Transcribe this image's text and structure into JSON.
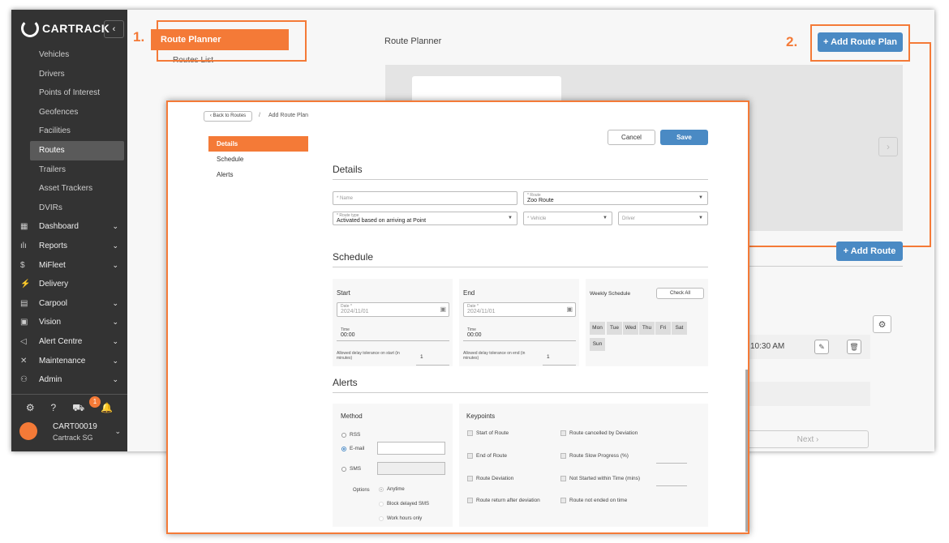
{
  "sidebar": {
    "brand": "CARTRACK",
    "collapse_icon": "‹",
    "subitems": [
      "Vehicles",
      "Drivers",
      "Points of Interest",
      "Geofences",
      "Facilities",
      "Routes",
      "Trailers",
      "Asset Trackers",
      "DVIRs"
    ],
    "active_sub": "Routes",
    "groups": [
      {
        "label": "Dashboard",
        "icon": "▦"
      },
      {
        "label": "Reports",
        "icon": "ılı"
      },
      {
        "label": "MiFleet",
        "icon": "$"
      },
      {
        "label": "Delivery",
        "icon": "⚡"
      },
      {
        "label": "Carpool",
        "icon": "▤"
      },
      {
        "label": "Vision",
        "icon": "▣"
      },
      {
        "label": "Alert Centre",
        "icon": "◁"
      },
      {
        "label": "Maintenance",
        "icon": "✕"
      },
      {
        "label": "Admin",
        "icon": "⚇"
      }
    ],
    "bottom_icons": [
      "⚙",
      "?",
      "⛟",
      "🔔"
    ],
    "notification_count": "1",
    "user_name": "CART00019",
    "user_org": "Cartrack SG"
  },
  "tabs": {
    "route_planner": "Route Planner",
    "routes_list": "Routes List"
  },
  "steps": {
    "one": "1.",
    "two": "2."
  },
  "background": {
    "title": "Route Planner",
    "add_route_plan": "+ Add Route Plan",
    "add_route": "+ Add Route",
    "time_cell": "10:30 AM",
    "next": "Next ›"
  },
  "modal": {
    "back": "‹  Back to Routes",
    "crumb_sep": "/",
    "crumb": "Add Route Plan",
    "nav": [
      "Details",
      "Schedule",
      "Alerts"
    ],
    "cancel": "Cancel",
    "save": "Save",
    "details": {
      "title": "Details",
      "name_label": "Name",
      "route_label": "Route",
      "route_value": "Zoo Route",
      "route_type_label": "Route type",
      "route_type_value": "Activated based on arriving at Point",
      "vehicle_label": "Vehicle",
      "driver_label": "Driver"
    },
    "schedule": {
      "title": "Schedule",
      "start": "Start",
      "end": "End",
      "date_label": "Date *",
      "start_date": "2024/11/01",
      "end_date": "2024/11/01",
      "time_label": "Time",
      "start_time": "00:00",
      "end_time": "00:00",
      "start_tol": "Allowed delay tolerance on start (in minutes)",
      "end_tol": "Allowed delay tolerance on end (in minutes)",
      "start_tol_val": "1",
      "end_tol_val": "1",
      "weekly": "Weekly Schedule",
      "check_all": "Check All",
      "days": [
        "Mon",
        "Tue",
        "Wed",
        "Thu",
        "Fri",
        "Sat",
        "Sun"
      ]
    },
    "alerts": {
      "title": "Alerts",
      "method": "Method",
      "rss": "RSS",
      "email": "E-mail",
      "sms": "SMS",
      "options": "Options",
      "anytime": "Anytime",
      "block_sms": "Block delayed SMS",
      "work_hours": "Work hours only",
      "keypoints": "Keypoints",
      "kp_left": [
        "Start of Route",
        "End of Route",
        "Route Deviation",
        "Route return after deviation"
      ],
      "kp_right": [
        "Route cancelled by Deviation",
        "Route Slow Progress (%)",
        "Not Started within Time (mins)",
        "Route not ended on time"
      ]
    }
  }
}
